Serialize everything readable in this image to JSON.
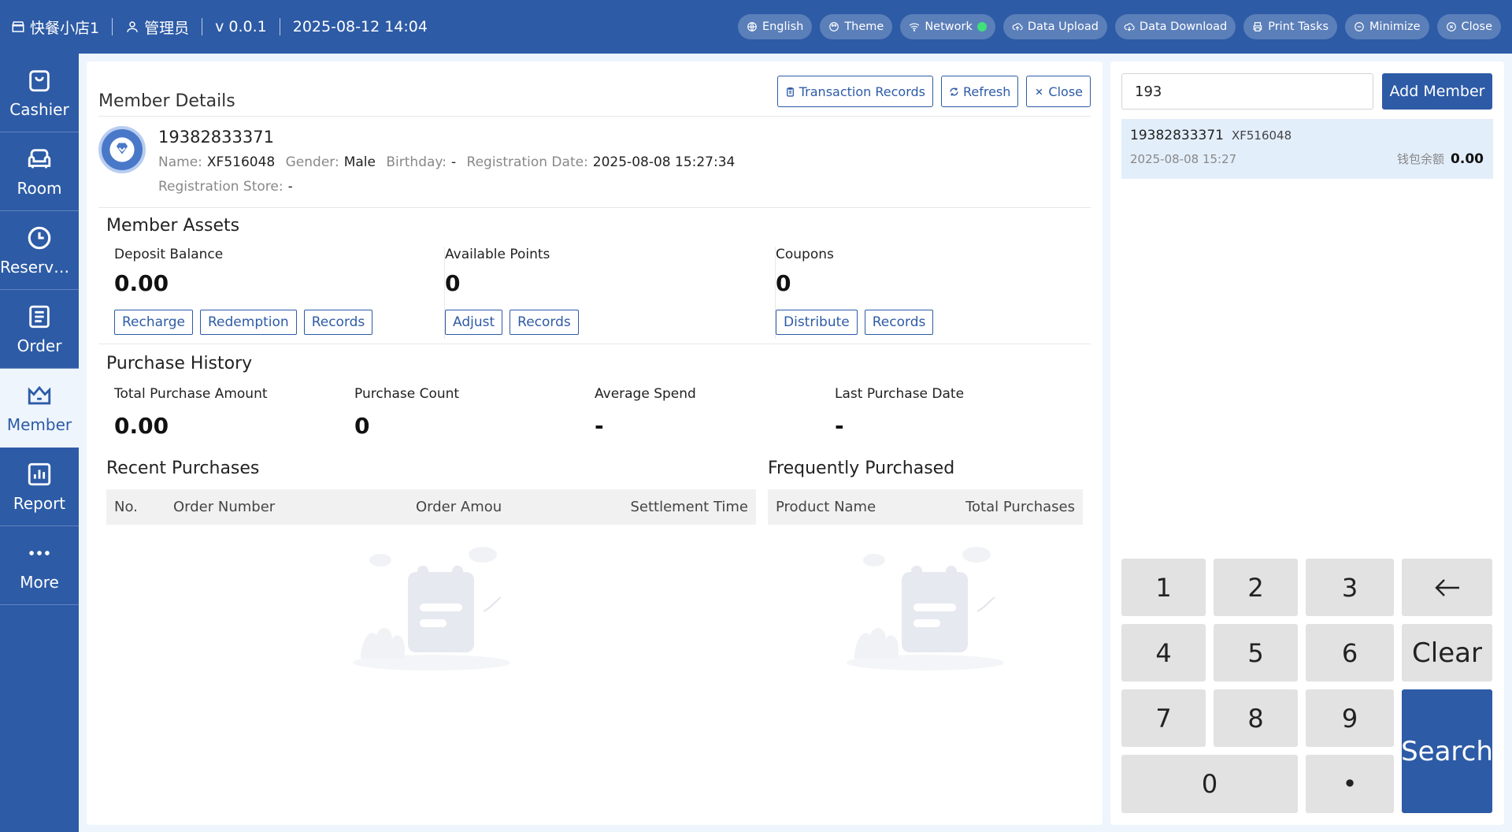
{
  "topbar": {
    "store": "快餐小店1",
    "user": "管理员",
    "version": "v 0.0.1",
    "datetime": "2025-08-12 14:04",
    "actions": {
      "language": "English",
      "theme": "Theme",
      "network": "Network",
      "upload": "Data Upload",
      "download": "Data Download",
      "print": "Print Tasks",
      "minimize": "Minimize",
      "close": "Close"
    },
    "network_status_color": "#3fe07a"
  },
  "sidebar": {
    "items": [
      {
        "label": "Cashier",
        "icon": "shopping-bag-icon"
      },
      {
        "label": "Room",
        "icon": "sofa-icon"
      },
      {
        "label": "Reserva…",
        "icon": "clock-icon"
      },
      {
        "label": "Order",
        "icon": "document-icon"
      },
      {
        "label": "Member",
        "icon": "crown-icon",
        "active": true
      },
      {
        "label": "Report",
        "icon": "bar-chart-icon"
      },
      {
        "label": "More",
        "icon": "more-icon"
      }
    ]
  },
  "detail": {
    "title": "Member Details",
    "actions": {
      "transactions": "Transaction Records",
      "refresh": "Refresh",
      "close": "Close"
    },
    "member": {
      "phone": "19382833371",
      "name_label": "Name:",
      "name": "XF516048",
      "gender_label": "Gender:",
      "gender": "Male",
      "birthday_label": "Birthday:",
      "birthday": "-",
      "reg_date_label": "Registration Date:",
      "reg_date": "2025-08-08 15:27:34",
      "reg_store_label": "Registration Store:",
      "reg_store": "-"
    },
    "assets": {
      "title": "Member Assets",
      "deposit": {
        "label": "Deposit Balance",
        "value": "0.00",
        "btn1": "Recharge",
        "btn2": "Redemption",
        "btn3": "Records"
      },
      "points": {
        "label": "Available Points",
        "value": "0",
        "btn1": "Adjust",
        "btn2": "Records"
      },
      "coupons": {
        "label": "Coupons",
        "value": "0",
        "btn1": "Distribute",
        "btn2": "Records"
      }
    },
    "history": {
      "title": "Purchase History",
      "total_amount": {
        "label": "Total Purchase Amount",
        "value": "0.00"
      },
      "count": {
        "label": "Purchase Count",
        "value": "0"
      },
      "average": {
        "label": "Average Spend",
        "value": "-"
      },
      "last_date": {
        "label": "Last Purchase Date",
        "value": "-"
      }
    },
    "recent": {
      "title": "Recent Purchases",
      "columns": [
        "No.",
        "Order Number",
        "Order Amou",
        "Settlement Time"
      ]
    },
    "frequent": {
      "title": "Frequently Purchased",
      "columns": [
        "Product Name",
        "Total Purchases"
      ]
    }
  },
  "search_panel": {
    "input_value": "193",
    "add_button": "Add Member",
    "result": {
      "phone": "19382833371",
      "name": "XF516048",
      "date": "2025-08-08 15:27",
      "wallet_label": "钱包余额",
      "wallet_value": "0.00"
    },
    "keypad": {
      "k1": "1",
      "k2": "2",
      "k3": "3",
      "back": "←",
      "k4": "4",
      "k5": "5",
      "k6": "6",
      "clear": "Clear",
      "k7": "7",
      "k8": "8",
      "k9": "9",
      "search": "Search",
      "k0": "0",
      "dot": "•"
    }
  },
  "colors": {
    "primary": "#2d5ba6",
    "page_bg": "#eef5fd",
    "highlight": "#e3eefb"
  }
}
